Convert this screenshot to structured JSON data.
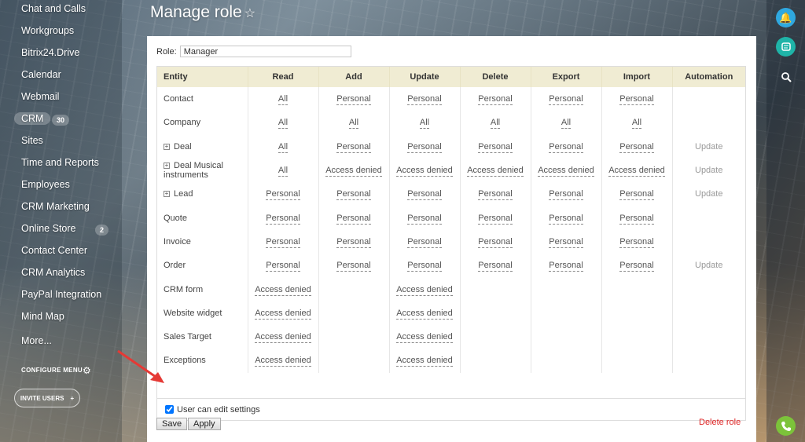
{
  "sidebar": {
    "items": [
      {
        "label": "Chat and Calls"
      },
      {
        "label": "Workgroups"
      },
      {
        "label": "Bitrix24.Drive"
      },
      {
        "label": "Calendar"
      },
      {
        "label": "Webmail"
      },
      {
        "label": "CRM",
        "badge": "30",
        "active": true
      },
      {
        "label": "Sites"
      },
      {
        "label": "Time and Reports"
      },
      {
        "label": "Employees"
      },
      {
        "label": "CRM Marketing"
      },
      {
        "label": "Online Store",
        "badge": "2"
      },
      {
        "label": "Contact Center"
      },
      {
        "label": "CRM Analytics"
      },
      {
        "label": "PayPal Integration"
      },
      {
        "label": "Mind Map"
      },
      {
        "label": "More..."
      }
    ],
    "configure_label": "CONFIGURE MENU",
    "invite_label": "INVITE USERS"
  },
  "page": {
    "title": "Manage role",
    "role_label": "Role:",
    "role_value": "Manager"
  },
  "table": {
    "headers": [
      "Entity",
      "Read",
      "Add",
      "Update",
      "Delete",
      "Export",
      "Import",
      "Automation"
    ],
    "rows": [
      {
        "entity": "Contact",
        "expandable": false,
        "cells": [
          "All",
          "Personal",
          "Personal",
          "Personal",
          "Personal",
          "Personal",
          ""
        ]
      },
      {
        "entity": "Company",
        "expandable": false,
        "cells": [
          "All",
          "All",
          "All",
          "All",
          "All",
          "All",
          ""
        ]
      },
      {
        "entity": "Deal",
        "expandable": true,
        "cells": [
          "All",
          "Personal",
          "Personal",
          "Personal",
          "Personal",
          "Personal",
          "Update"
        ]
      },
      {
        "entity": "Deal Musical instruments",
        "expandable": true,
        "cells": [
          "All",
          "Access denied",
          "Access denied",
          "Access denied",
          "Access denied",
          "Access denied",
          "Update"
        ]
      },
      {
        "entity": "Lead",
        "expandable": true,
        "cells": [
          "Personal",
          "Personal",
          "Personal",
          "Personal",
          "Personal",
          "Personal",
          "Update"
        ]
      },
      {
        "entity": "Quote",
        "expandable": false,
        "cells": [
          "Personal",
          "Personal",
          "Personal",
          "Personal",
          "Personal",
          "Personal",
          ""
        ]
      },
      {
        "entity": "Invoice",
        "expandable": false,
        "cells": [
          "Personal",
          "Personal",
          "Personal",
          "Personal",
          "Personal",
          "Personal",
          ""
        ]
      },
      {
        "entity": "Order",
        "expandable": false,
        "cells": [
          "Personal",
          "Personal",
          "Personal",
          "Personal",
          "Personal",
          "Personal",
          "Update"
        ]
      },
      {
        "entity": "CRM form",
        "expandable": false,
        "cells": [
          "Access denied",
          "",
          "Access denied",
          "",
          "",
          "",
          ""
        ]
      },
      {
        "entity": "Website widget",
        "expandable": false,
        "cells": [
          "Access denied",
          "",
          "Access denied",
          "",
          "",
          "",
          ""
        ]
      },
      {
        "entity": "Sales Target",
        "expandable": false,
        "cells": [
          "Access denied",
          "",
          "Access denied",
          "",
          "",
          "",
          ""
        ]
      },
      {
        "entity": "Exceptions",
        "expandable": false,
        "cells": [
          "Access denied",
          "",
          "Access denied",
          "",
          "",
          "",
          ""
        ]
      }
    ]
  },
  "settings": {
    "checkbox_label": "User can edit settings",
    "checked": true
  },
  "buttons": {
    "save": "Save",
    "apply": "Apply",
    "delete_role": "Delete role"
  },
  "colors": {
    "header_bg": "#f0ecd3",
    "delete": "#dd2222",
    "notify": "#2fa8e0",
    "chat": "#1fb4a8",
    "phone": "#7cc33a"
  }
}
